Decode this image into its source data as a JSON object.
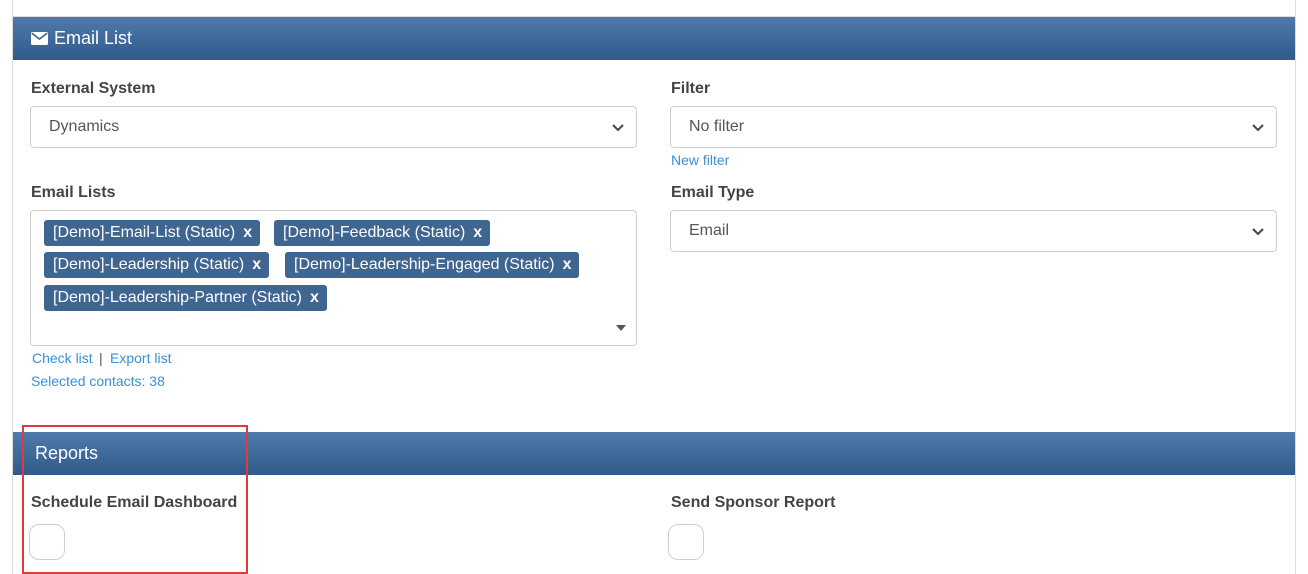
{
  "email_panel": {
    "title": "Email List",
    "icon": "envelope-icon",
    "external_system": {
      "label": "External System",
      "value": "Dynamics"
    },
    "filter": {
      "label": "Filter",
      "value": "No filter",
      "new_filter_link": "New filter"
    },
    "email_lists": {
      "label": "Email Lists",
      "tags": [
        "[Demo]-Email-List (Static)",
        "[Demo]-Feedback (Static)",
        "[Demo]-Leadership (Static)",
        "[Demo]-Leadership-Engaged (Static)",
        "[Demo]-Leadership-Partner (Static)"
      ],
      "remove_glyph": "x",
      "check_list_link": "Check list",
      "separator": "|",
      "export_list_link": "Export list",
      "selected_contacts": "Selected contacts: 38"
    },
    "email_type": {
      "label": "Email Type",
      "value": "Email"
    }
  },
  "reports_panel": {
    "title": "Reports",
    "schedule_email_dashboard": {
      "label": "Schedule Email Dashboard"
    },
    "send_sponsor_report": {
      "label": "Send Sponsor Report"
    }
  },
  "colors": {
    "header_gradient_top": "#4f7aab",
    "header_gradient_bottom": "#2f5a8a",
    "tag_bg": "#3f6591",
    "link": "#3b8fd4",
    "highlight": "#e03b3b"
  }
}
